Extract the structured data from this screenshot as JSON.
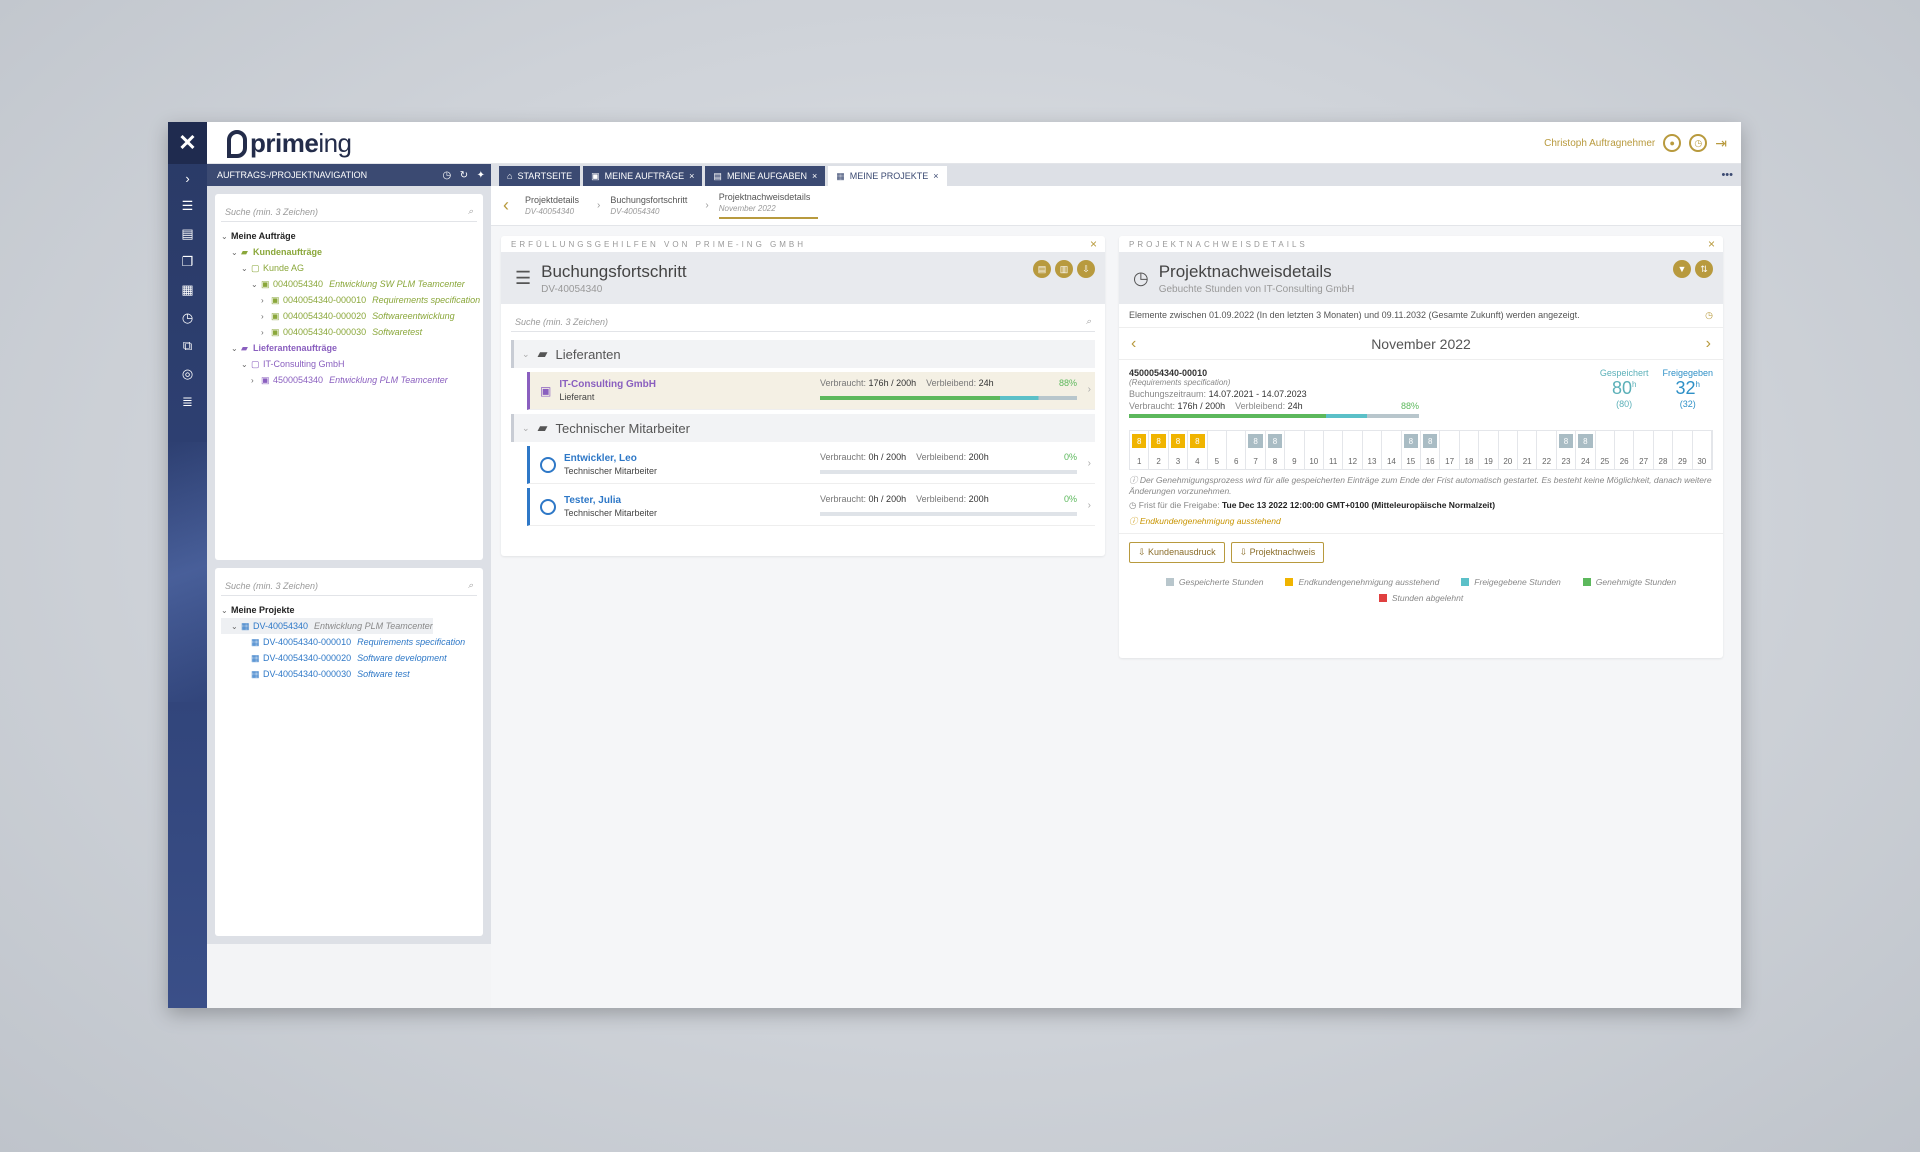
{
  "app": {
    "brand_name": "prime",
    "brand_suffix": "ing",
    "user_name": "Christoph Auftragnehmer"
  },
  "colors": {
    "gold": "#b89a3e",
    "navy": "#3b4a72",
    "green": "#5cb85c",
    "teal": "#5bc0c8",
    "orange": "#f0b400",
    "red": "#e04040",
    "gray": "#b8c6cc"
  },
  "nav": {
    "title": "AUFTRAGS-/PROJEKTNAVIGATION",
    "search1_placeholder": "Suche (min. 3 Zeichen)",
    "search2_placeholder": "Suche (min. 3 Zeichen)",
    "tree1": {
      "root": "Meine Aufträge",
      "kunden": "Kundenaufträge",
      "kunde": "Kunde AG",
      "k_order": {
        "id": "0040054340",
        "desc": "Entwicklung SW PLM Teamcenter"
      },
      "k_items": [
        {
          "id": "0040054340-000010",
          "desc": "Requirements specification"
        },
        {
          "id": "0040054340-000020",
          "desc": "Softwareentwicklung"
        },
        {
          "id": "0040054340-000030",
          "desc": "Softwaretest"
        }
      ],
      "lief": "Lieferantenaufträge",
      "lieferant": "IT-Consulting GmbH",
      "l_order": {
        "id": "4500054340",
        "desc": "Entwicklung PLM Teamcenter"
      }
    },
    "tree2": {
      "root": "Meine Projekte",
      "project": {
        "id": "DV-40054340",
        "desc": "Entwicklung PLM Teamcenter"
      },
      "items": [
        {
          "id": "DV-40054340-000010",
          "desc": "Requirements specification"
        },
        {
          "id": "DV-40054340-000020",
          "desc": "Software development"
        },
        {
          "id": "DV-40054340-000030",
          "desc": "Software test"
        }
      ]
    }
  },
  "tabs": [
    {
      "label": "STARTSEITE"
    },
    {
      "label": "MEINE AUFTRÄGE"
    },
    {
      "label": "MEINE AUFGABEN"
    },
    {
      "label": "MEINE PROJEKTE"
    }
  ],
  "breadcrumb": [
    {
      "label": "Projektdetails",
      "sub": "DV-40054340"
    },
    {
      "label": "Buchungsfortschritt",
      "sub": "DV-40054340"
    },
    {
      "label": "Projektnachweisdetails",
      "sub": "November 2022"
    }
  ],
  "left_card": {
    "top": "ERFÜLLUNGSGEHILFEN VON PRIME-ING GMBH",
    "title": "Buchungsfortschritt",
    "subtitle": "DV-40054340",
    "search_placeholder": "Suche (min. 3 Zeichen)",
    "group1": "Lieferanten",
    "group2": "Technischer Mitarbeiter",
    "rows": [
      {
        "name": "IT-Consulting GmbH",
        "role": "Lieferant",
        "used_label": "Verbraucht:",
        "used": "176h / 200h",
        "rem_label": "Verbleibend:",
        "rem": "24h",
        "pct": "88%",
        "fill": 0.88
      },
      {
        "name": "Entwickler, Leo",
        "role": "Technischer Mitarbeiter",
        "used_label": "Verbraucht:",
        "used": "0h / 200h",
        "rem_label": "Verbleibend:",
        "rem": "200h",
        "pct": "0%",
        "fill": 0
      },
      {
        "name": "Tester, Julia",
        "role": "Technischer Mitarbeiter",
        "used_label": "Verbraucht:",
        "used": "0h / 200h",
        "rem_label": "Verbleibend:",
        "rem": "200h",
        "pct": "0%",
        "fill": 0
      }
    ]
  },
  "right_card": {
    "top": "PROJEKTNACHWEISDETAILS",
    "title": "Projektnachweisdetails",
    "subtitle": "Gebuchte Stunden von IT-Consulting GmbH",
    "info": "Elemente zwischen 01.09.2022 (In den letzten 3 Monaten) und 09.11.2032 (Gesamte Zukunft) werden angezeigt.",
    "month": "November 2022",
    "item_id": "4500054340-00010",
    "item_desc": "(Requirements specification)",
    "period_label": "Buchungszeitraum:",
    "period": "14.07.2021 - 14.07.2023",
    "used_label": "Verbraucht:",
    "used": "176h / 200h",
    "rem_label": "Verbleibend:",
    "rem": "24h",
    "pct": "88%",
    "saved_label": "Gespeichert",
    "saved_val": "80",
    "saved_unit": "h",
    "saved_sub": "(80)",
    "rel_label": "Freigegeben",
    "rel_val": "32",
    "rel_unit": "h",
    "rel_sub": "(32)",
    "days": [
      {
        "d": "1",
        "h": "8",
        "s": "o"
      },
      {
        "d": "2",
        "h": "8",
        "s": "o"
      },
      {
        "d": "3",
        "h": "8",
        "s": "o"
      },
      {
        "d": "4",
        "h": "8",
        "s": "o"
      },
      {
        "d": "5",
        "h": "",
        "s": ""
      },
      {
        "d": "6",
        "h": "",
        "s": ""
      },
      {
        "d": "7",
        "h": "8",
        "s": "g"
      },
      {
        "d": "8",
        "h": "8",
        "s": "g"
      },
      {
        "d": "9",
        "h": "",
        "s": ""
      },
      {
        "d": "10",
        "h": "",
        "s": ""
      },
      {
        "d": "11",
        "h": "",
        "s": ""
      },
      {
        "d": "12",
        "h": "",
        "s": ""
      },
      {
        "d": "13",
        "h": "",
        "s": ""
      },
      {
        "d": "14",
        "h": "",
        "s": ""
      },
      {
        "d": "15",
        "h": "8",
        "s": "g"
      },
      {
        "d": "16",
        "h": "8",
        "s": "g"
      },
      {
        "d": "17",
        "h": "",
        "s": ""
      },
      {
        "d": "18",
        "h": "",
        "s": ""
      },
      {
        "d": "19",
        "h": "",
        "s": ""
      },
      {
        "d": "20",
        "h": "",
        "s": ""
      },
      {
        "d": "21",
        "h": "",
        "s": ""
      },
      {
        "d": "22",
        "h": "",
        "s": ""
      },
      {
        "d": "23",
        "h": "8",
        "s": "g"
      },
      {
        "d": "24",
        "h": "8",
        "s": "g"
      },
      {
        "d": "25",
        "h": "",
        "s": ""
      },
      {
        "d": "26",
        "h": "",
        "s": ""
      },
      {
        "d": "27",
        "h": "",
        "s": ""
      },
      {
        "d": "28",
        "h": "",
        "s": ""
      },
      {
        "d": "29",
        "h": "",
        "s": ""
      },
      {
        "d": "30",
        "h": "",
        "s": ""
      }
    ],
    "note1": "Der Genehmigungsprozess wird für alle gespeicherten Einträge zum Ende der Frist automatisch gestartet. Es besteht keine Möglichkeit, danach weitere Änderungen vorzunehmen.",
    "deadline_label": "Frist für die Freigabe:",
    "deadline": "Tue Dec 13 2022 12:00:00 GMT+0100 (Mitteleuropäische Normalzeit)",
    "status": "Endkundengenehmigung ausstehend",
    "btn1": "Kundenausdruck",
    "btn2": "Projektnachweis",
    "legend": [
      {
        "label": "Gespeicherte Stunden",
        "color": "#b8c6cc"
      },
      {
        "label": "Endkundengenehmigung ausstehend",
        "color": "#f0b400"
      },
      {
        "label": "Freigegebene Stunden",
        "color": "#5bc0c8"
      },
      {
        "label": "Genehmigte Stunden",
        "color": "#5cb85c"
      },
      {
        "label": "Stunden abgelehnt",
        "color": "#e04040"
      }
    ]
  }
}
